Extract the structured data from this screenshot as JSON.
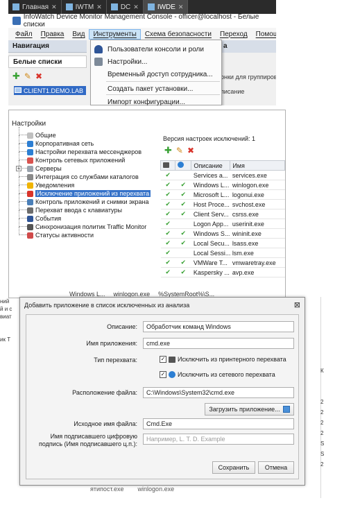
{
  "tabs": [
    {
      "label": "Главная",
      "active": false
    },
    {
      "label": "IWTM",
      "active": false
    },
    {
      "label": "DC",
      "active": false
    },
    {
      "label": "IWDE",
      "active": true
    }
  ],
  "window_title": "InfoWatch Device Monitor Management Console - officer@localhost - Белые списки",
  "menubar": [
    "Файл",
    "Правка",
    "Вид",
    "Инструменты",
    "Схема безопасности",
    "Переход",
    "Помощь"
  ],
  "navigation": {
    "header": "Навигация",
    "section": "Белые списки",
    "client": "CLIENT1.DEMO.LAB"
  },
  "right_panel": {
    "header": "a",
    "text1": "онки для группиров",
    "text2": "писание"
  },
  "tools_menu": {
    "items": [
      {
        "label": "Пользователи консоли и роли",
        "icon": "users-icon"
      },
      {
        "label": "Настройки...",
        "icon": "settings-icon"
      },
      {
        "label": "Временный доступ сотрудника...",
        "icon": ""
      },
      {
        "label": "Создать пакет установки...",
        "icon": ""
      },
      {
        "label": "Импорт конфигурации...",
        "icon": ""
      }
    ]
  },
  "settings": {
    "title": "Настройки",
    "tree": [
      {
        "label": "Общие",
        "icon": "gear-icon",
        "color": "#c0c0c0",
        "selected": false,
        "expander": false
      },
      {
        "label": "Корпоративная сеть",
        "icon": "network-icon",
        "color": "#2d7fd3",
        "selected": false,
        "expander": false
      },
      {
        "label": "Настройки перехвата мессенджеров",
        "icon": "messenger-icon",
        "color": "#2d7fd3",
        "selected": false,
        "expander": false
      },
      {
        "label": "Контроль сетевых приложений",
        "icon": "network-apps-icon",
        "color": "#d9534f",
        "selected": false,
        "expander": false
      },
      {
        "label": "Серверы",
        "icon": "servers-icon",
        "color": "#9aa3ad",
        "selected": false,
        "expander": true
      },
      {
        "label": "Интеграция со службами каталогов",
        "icon": "directory-icon",
        "color": "#8a8a8a",
        "selected": false,
        "expander": false
      },
      {
        "label": "Уведомления",
        "icon": "warning-icon",
        "color": "#f0b400",
        "selected": false,
        "expander": false
      },
      {
        "label": "Исключение приложений из перехвата",
        "icon": "block-icon",
        "color": "#d9342b",
        "selected": true,
        "expander": false
      },
      {
        "label": "Контроль приложений и снимки экрана",
        "icon": "screen-icon",
        "color": "#4a7fb8",
        "selected": false,
        "expander": false
      },
      {
        "label": "Перехват ввода с клавиатуры",
        "icon": "keyboard-icon",
        "color": "#6c6c6c",
        "selected": false,
        "expander": false
      },
      {
        "label": "События",
        "icon": "flag-icon",
        "color": "#2f5597",
        "selected": false,
        "expander": false
      },
      {
        "label": "Синхронизация политик Traffic Monitor",
        "icon": "sync-icon",
        "color": "#555555",
        "selected": false,
        "expander": false
      },
      {
        "label": "Статусы активности",
        "icon": "activity-icon",
        "color": "#d04a4a",
        "selected": false,
        "expander": false
      }
    ],
    "version_line": "Версия настроек исключений: 1",
    "table": {
      "columns": [
        "",
        "",
        "Описание",
        "Имя"
      ],
      "rows": [
        {
          "print": true,
          "net": false,
          "desc": "Services a...",
          "name": "services.exe"
        },
        {
          "print": true,
          "net": true,
          "desc": "Windows L...",
          "name": "winlogon.exe"
        },
        {
          "print": true,
          "net": true,
          "desc": "Microsoft L...",
          "name": "logonui.exe"
        },
        {
          "print": true,
          "net": true,
          "desc": "Host Proce...",
          "name": "svchost.exe"
        },
        {
          "print": true,
          "net": true,
          "desc": "Client Serv...",
          "name": "csrss.exe"
        },
        {
          "print": true,
          "net": false,
          "desc": "Logon App...",
          "name": "userinit.exe"
        },
        {
          "print": true,
          "net": true,
          "desc": "Windows S...",
          "name": "wininit.exe"
        },
        {
          "print": true,
          "net": true,
          "desc": "Local Secu...",
          "name": "lsass.exe"
        },
        {
          "print": true,
          "net": false,
          "desc": "Local Sessi...",
          "name": "lsm.exe"
        },
        {
          "print": true,
          "net": true,
          "desc": "VMWare T...",
          "name": "vmwaretray.exe"
        },
        {
          "print": true,
          "net": true,
          "desc": "Kaspersky ...",
          "name": "avp.exe"
        }
      ]
    }
  },
  "background": {
    "left_fragments": [
      "ний",
      "й и с",
      "виат",
      "",
      "",
      "ик Т"
    ],
    "strip": [
      "Windows L...",
      "winlogon.exe",
      "%SystemRoot%\\S..."
    ],
    "bottom": [
      "ятипост.exe",
      "winlogon.exe"
    ],
    "right_fragments": [
      "К",
      "",
      "",
      "2",
      "2",
      "2",
      "2",
      "S",
      "S",
      "2"
    ]
  },
  "dialog": {
    "title": "Добавить приложение в список исключенных из анализа",
    "close": "⊠",
    "description_label": "Описание:",
    "description_value": "Обработчик команд Windows",
    "app_name_label": "Имя приложения:",
    "app_name_value": "cmd.exe",
    "intercept_type_label": "Тип перехвата:",
    "exclude_printer_label": "Исключить из принтерного перехвата",
    "exclude_printer_checked": true,
    "exclude_network_label": "Исключить из сетевого перехвата",
    "exclude_network_checked": true,
    "file_location_label": "Расположение файла:",
    "file_location_value": "C:\\Windows\\System32\\cmd.exe",
    "load_app_button": "Загрузить приложение...",
    "original_name_label": "Исходное имя файла:",
    "original_name_value": "Cmd.Exe",
    "signer_label_1": "Имя подписавшего цифровую",
    "signer_label_2": "подпись (Имя подписавшего ц.п.):",
    "signer_placeholder": "Например, L. T. D. Example",
    "save_button": "Сохранить",
    "cancel_button": "Отмена"
  }
}
